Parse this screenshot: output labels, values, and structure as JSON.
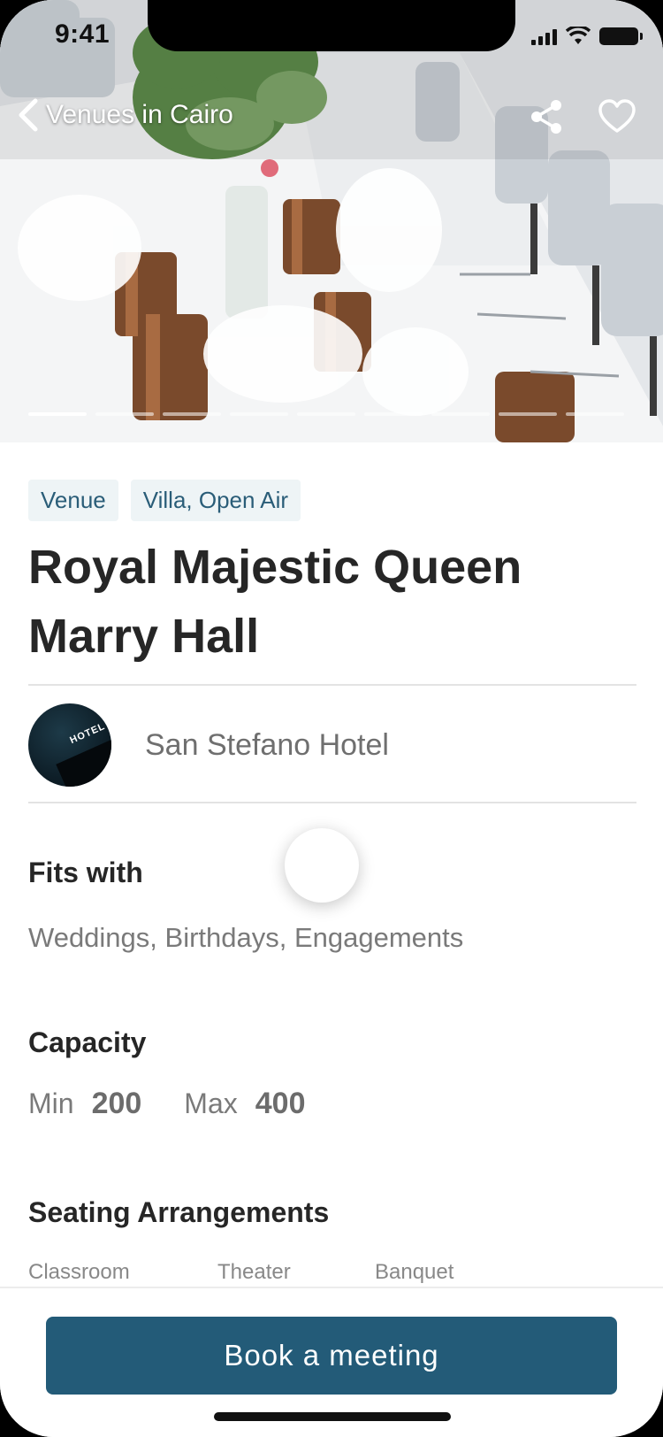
{
  "status_bar": {
    "time": "9:41"
  },
  "nav": {
    "back_label": "Venues in Cairo",
    "icons": {
      "back": "chevron-left-icon",
      "share": "share-icon",
      "favorite": "heart-outline-icon"
    }
  },
  "gallery": {
    "page_count": 9,
    "active_index": 0
  },
  "venue": {
    "tags": [
      "Venue",
      "Villa, Open Air"
    ],
    "title": "Royal Majestic Queen Marry Hall",
    "host": {
      "name": "San Stefano Hotel",
      "logo_text": "HOTEL"
    }
  },
  "fits_with": {
    "title": "Fits with",
    "text": "Weddings, Birthdays, Engagements"
  },
  "capacity": {
    "title": "Capacity",
    "min_label": "Min",
    "min_value": "200",
    "max_label": "Max",
    "max_value": "400"
  },
  "seating": {
    "title": "Seating Arrangements",
    "options": [
      "Classroom",
      "Theater",
      "Banquet"
    ]
  },
  "cta": {
    "label": "Book a meeting"
  },
  "colors": {
    "primary": "#235b78",
    "tag_bg": "#eef4f6",
    "tag_text": "#2a5d78"
  }
}
